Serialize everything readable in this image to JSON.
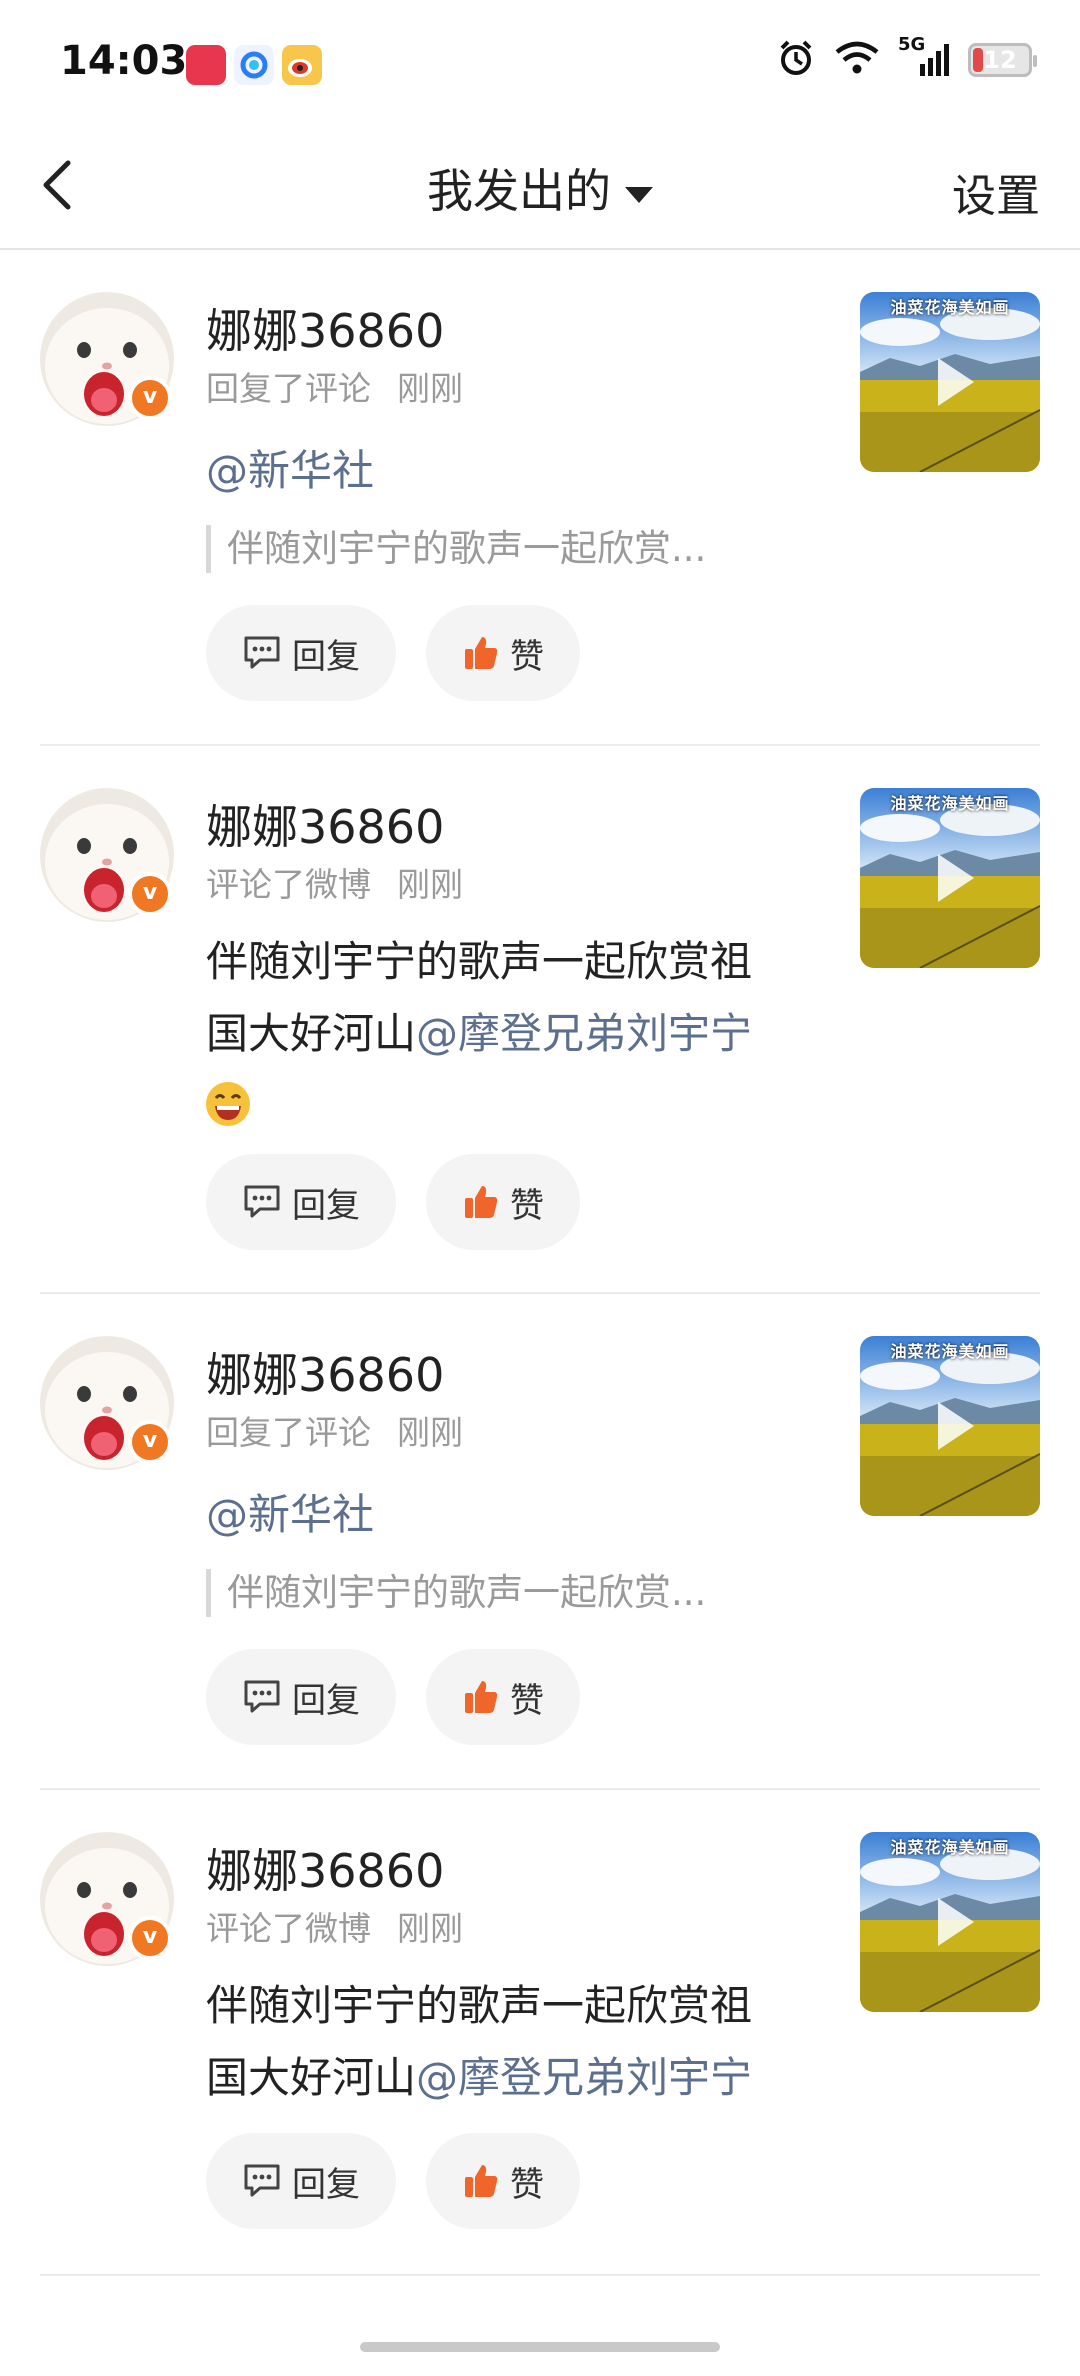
{
  "status_bar": {
    "time": "14:03",
    "network": "5G",
    "battery": "12",
    "app_icons": [
      "xiaohongshu-icon",
      "qq-browser-icon",
      "weibo-icon"
    ],
    "system_icons": [
      "alarm-icon",
      "wifi-icon",
      "signal-icon",
      "battery-icon"
    ]
  },
  "nav": {
    "title": "我发出的",
    "settings_label": "设置"
  },
  "colors": {
    "mention": "#5c6f8e",
    "meta": "#9a9a9a",
    "badge": "#f07823",
    "like_icon": "#f0652a"
  },
  "items": [
    {
      "name": "娜娜36860",
      "action": "回复了评论",
      "time": "刚刚",
      "mention": "@新华社",
      "quote": "伴随刘宇宁的歌声一起欣赏...",
      "reply_label": "回复",
      "like_label": "赞",
      "thumb_caption": "油菜花海美如画"
    },
    {
      "name": "娜娜36860",
      "action": "评论了微博",
      "time": "刚刚",
      "text_line1": "伴随刘宇宁的歌声一起欣赏祖",
      "text_line2": "国大好河山",
      "mention": "@摩登兄弟刘宇宁",
      "emoji": "grinning-emoji",
      "reply_label": "回复",
      "like_label": "赞",
      "thumb_caption": "油菜花海美如画"
    },
    {
      "name": "娜娜36860",
      "action": "回复了评论",
      "time": "刚刚",
      "mention": "@新华社",
      "quote": "伴随刘宇宁的歌声一起欣赏...",
      "reply_label": "回复",
      "like_label": "赞",
      "thumb_caption": "油菜花海美如画"
    },
    {
      "name": "娜娜36860",
      "action": "评论了微博",
      "time": "刚刚",
      "text_line1": "伴随刘宇宁的歌声一起欣赏祖",
      "text_line2": "国大好河山",
      "mention": "@摩登兄弟刘宇宁",
      "reply_label": "回复",
      "like_label": "赞",
      "thumb_caption": "油菜花海美如画"
    }
  ]
}
